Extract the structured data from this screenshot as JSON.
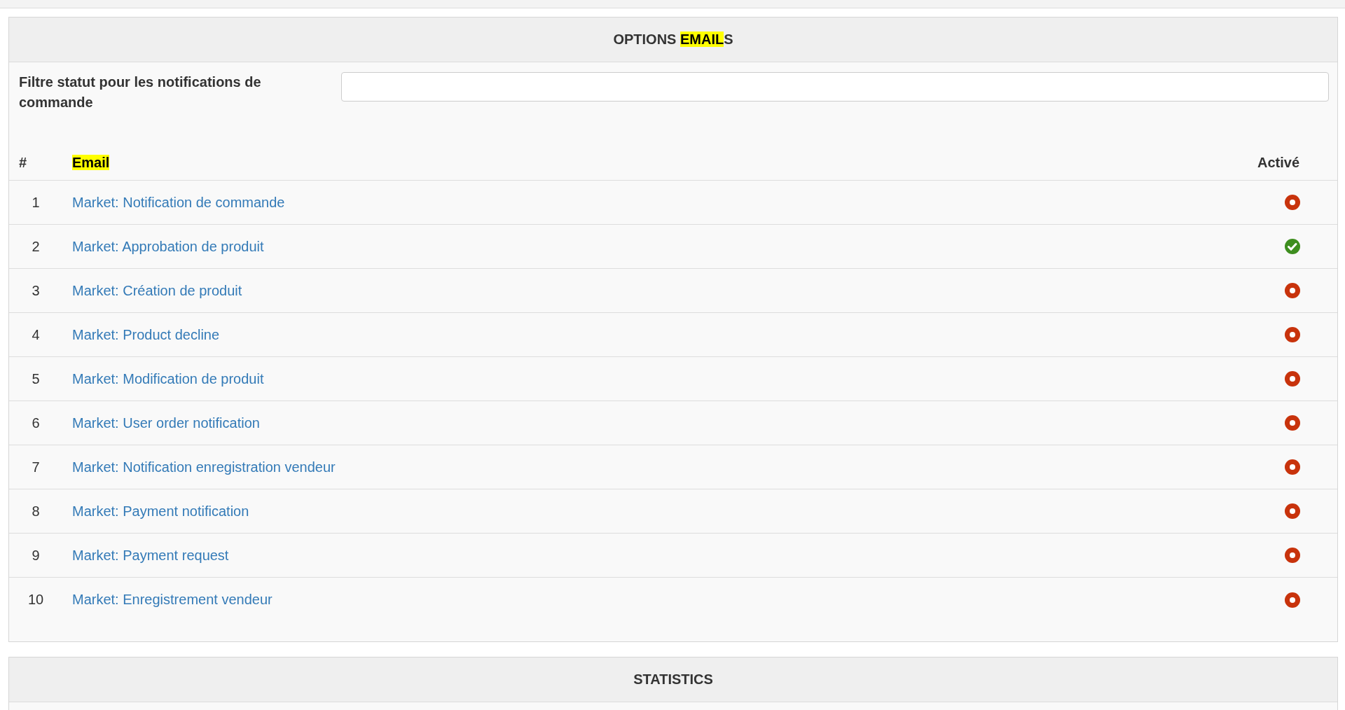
{
  "emails_panel": {
    "title": [
      {
        "text": "OPTIONS ",
        "highlighted": false
      },
      {
        "text": "EMAIL",
        "highlighted": true
      },
      {
        "text": "S",
        "highlighted": false
      }
    ],
    "filter": {
      "label": "Filtre statut pour les notifications de commande"
    },
    "table": {
      "columns": [
        {
          "label": "#",
          "highlighted": false
        },
        {
          "label": "Email",
          "highlighted": true
        },
        {
          "label": "Activé",
          "highlighted": false
        }
      ],
      "rows": [
        {
          "number": "1",
          "email": "Market: Notification de commande",
          "active": false
        },
        {
          "number": "2",
          "email": "Market: Approbation de produit",
          "active": true
        },
        {
          "number": "3",
          "email": "Market: Création de produit",
          "active": false
        },
        {
          "number": "4",
          "email": "Market: Product decline",
          "active": false
        },
        {
          "number": "5",
          "email": "Market: Modification de produit",
          "active": false
        },
        {
          "number": "6",
          "email": "Market: User order notification",
          "active": false
        },
        {
          "number": "7",
          "email": "Market: Notification enregistration vendeur",
          "active": false
        },
        {
          "number": "8",
          "email": "Market: Payment notification",
          "active": false
        },
        {
          "number": "9",
          "email": "Market: Payment request",
          "active": false
        },
        {
          "number": "10",
          "email": "Market: Enregistrement vendeur",
          "active": false
        }
      ]
    }
  },
  "statistics_panel": {
    "title": "STATISTICS"
  }
}
